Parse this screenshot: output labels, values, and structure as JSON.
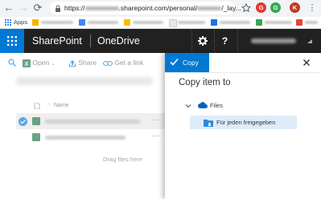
{
  "browser": {
    "url_prefix": "https://",
    "url_mid": ".sharepoint.com/personal/",
    "url_suffix": "/_lay...",
    "apps_label": "Apps",
    "ext_badges": [
      {
        "letter": "G",
        "color": "#e53935"
      },
      {
        "letter": "G",
        "color": "#34a853"
      },
      {
        "letter": "K",
        "color": "#c0392b"
      }
    ]
  },
  "suite": {
    "brand": "SharePoint",
    "app": "OneDrive"
  },
  "commands": {
    "open": "Open",
    "share": "Share",
    "get_link": "Get a link"
  },
  "list": {
    "name_header": "Name",
    "drag_hint": "Drag files here"
  },
  "copy_panel": {
    "tab_label": "Copy",
    "title": "Copy item to",
    "root_label": "Files",
    "selected_folder": "Für jeden freigegeben"
  },
  "colors": {
    "accent": "#0078d4",
    "suite_bar": "#212121",
    "selected_folder_bg": "#deecf9"
  }
}
